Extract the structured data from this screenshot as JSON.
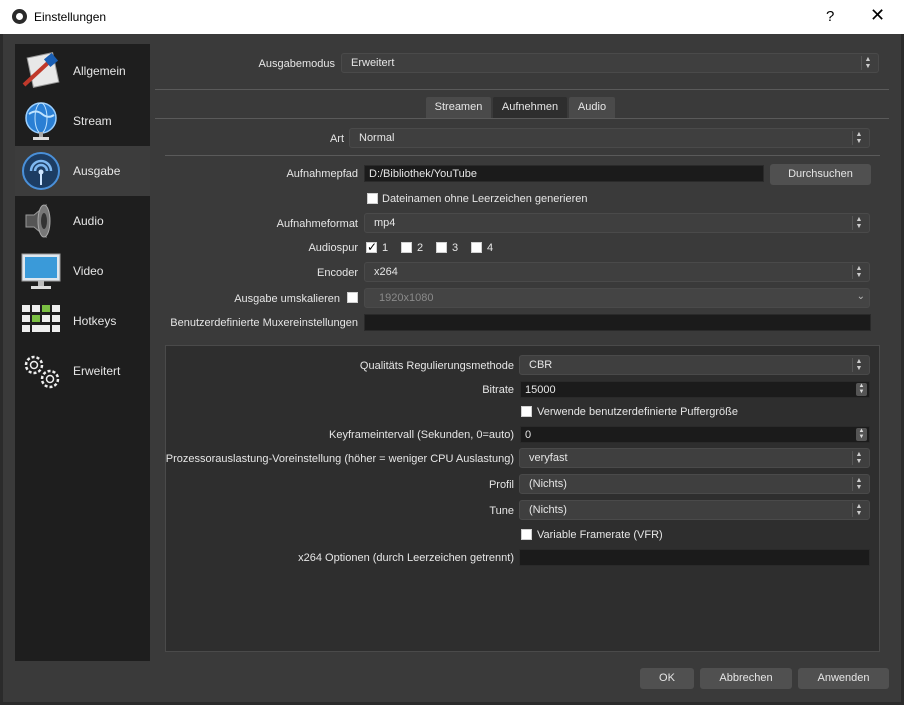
{
  "window": {
    "title": "Einstellungen",
    "help": "?",
    "close": "✕"
  },
  "sidebar": {
    "items": [
      {
        "label": "Allgemein",
        "icon": "general-icon"
      },
      {
        "label": "Stream",
        "icon": "globe-icon"
      },
      {
        "label": "Ausgabe",
        "icon": "broadcast-icon",
        "active": true
      },
      {
        "label": "Audio",
        "icon": "speaker-icon"
      },
      {
        "label": "Video",
        "icon": "monitor-icon"
      },
      {
        "label": "Hotkeys",
        "icon": "keyboard-icon"
      },
      {
        "label": "Erweitert",
        "icon": "gears-icon"
      }
    ]
  },
  "output": {
    "mode_label": "Ausgabemodus",
    "mode_value": "Erweitert",
    "tabs": [
      "Streamen",
      "Aufnehmen",
      "Audio"
    ],
    "active_tab": "Aufnehmen",
    "type_label": "Art",
    "type_value": "Normal"
  },
  "recording": {
    "path_label": "Aufnahmepfad",
    "path_value": "D:/Bibliothek/YouTube",
    "browse_label": "Durchsuchen",
    "nospace_label": "Dateinamen ohne Leerzeichen generieren",
    "format_label": "Aufnahmeformat",
    "format_value": "mp4",
    "tracks_label": "Audiospur",
    "tracks": [
      "1",
      "2",
      "3",
      "4"
    ],
    "encoder_label": "Encoder",
    "encoder_value": "x264",
    "rescale_label": "Ausgabe umskalieren",
    "rescale_value": "1920x1080",
    "muxer_label": "Benutzerdefinierte Muxereinstellungen",
    "muxer_value": ""
  },
  "encoder_settings": {
    "rate_control_label": "Qualitäts Regulierungsmethode",
    "rate_control_value": "CBR",
    "bitrate_label": "Bitrate",
    "bitrate_value": "15000",
    "custom_buffer_label": "Verwende benutzerdefinierte Puffergröße",
    "keyframe_label": "Keyframeintervall (Sekunden, 0=auto)",
    "keyframe_value": "0",
    "preset_label": "Prozessorauslastung-Voreinstellung (höher = weniger CPU Auslastung)",
    "preset_value": "veryfast",
    "profile_label": "Profil",
    "profile_value": "(Nichts)",
    "tune_label": "Tune",
    "tune_value": "(Nichts)",
    "vfr_label": "Variable Framerate (VFR)",
    "options_label": "x264 Optionen (durch Leerzeichen getrennt)",
    "options_value": ""
  },
  "footer": {
    "ok": "OK",
    "cancel": "Abbrechen",
    "apply": "Anwenden"
  }
}
